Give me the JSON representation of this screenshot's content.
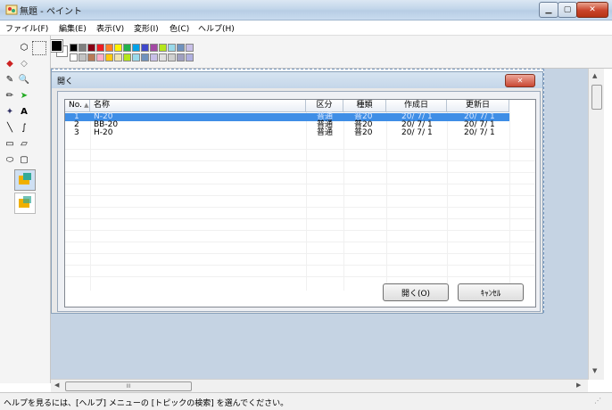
{
  "window": {
    "title": "無題 - ペイント"
  },
  "menu": [
    "ファイル(F)",
    "編集(E)",
    "表示(V)",
    "変形(I)",
    "色(C)",
    "ヘルプ(H)"
  ],
  "palette": {
    "top": [
      "#000000",
      "#7f7f7f",
      "#880015",
      "#ed1c24",
      "#ff7f27",
      "#fff200",
      "#22b14c",
      "#00a2e8",
      "#3f48cc",
      "#a349a4",
      "#b5e61d",
      "#99d9ea",
      "#7092be",
      "#c8bfe7"
    ],
    "bottom": [
      "#ffffff",
      "#c3c3c3",
      "#b97a57",
      "#ffaec9",
      "#ffc90e",
      "#efe4b0",
      "#b5e61d",
      "#99d9ea",
      "#7092be",
      "#c8bfe7",
      "#e0e0e0",
      "#d0d0d0",
      "#a0a0c0",
      "#b0b0e0"
    ]
  },
  "dialog": {
    "title": "開く",
    "columns": [
      "No.",
      "名称",
      "区分",
      "種類",
      "作成日",
      "更新日"
    ],
    "rows": [
      {
        "no": "1",
        "name": "N-20",
        "kubun": "普通",
        "shurui": "普20",
        "created": "20/ 7/ 1",
        "updated": "20/ 7/ 1",
        "selected": true
      },
      {
        "no": "2",
        "name": "BB-20",
        "kubun": "普通",
        "shurui": "普20",
        "created": "20/ 7/ 1",
        "updated": "20/ 7/ 1",
        "selected": false
      },
      {
        "no": "3",
        "name": "H-20",
        "kubun": "普通",
        "shurui": "普20",
        "created": "20/ 7/ 1",
        "updated": "20/ 7/ 1",
        "selected": false
      }
    ],
    "open_label": "開く(O)",
    "cancel_label": "ｷｬﾝｾﾙ"
  },
  "status": {
    "text": "ヘルプを見るには、[ヘルプ] メニューの [トピックの検索] を選んでください。"
  },
  "scroll": {
    "h_thumb": "III"
  }
}
